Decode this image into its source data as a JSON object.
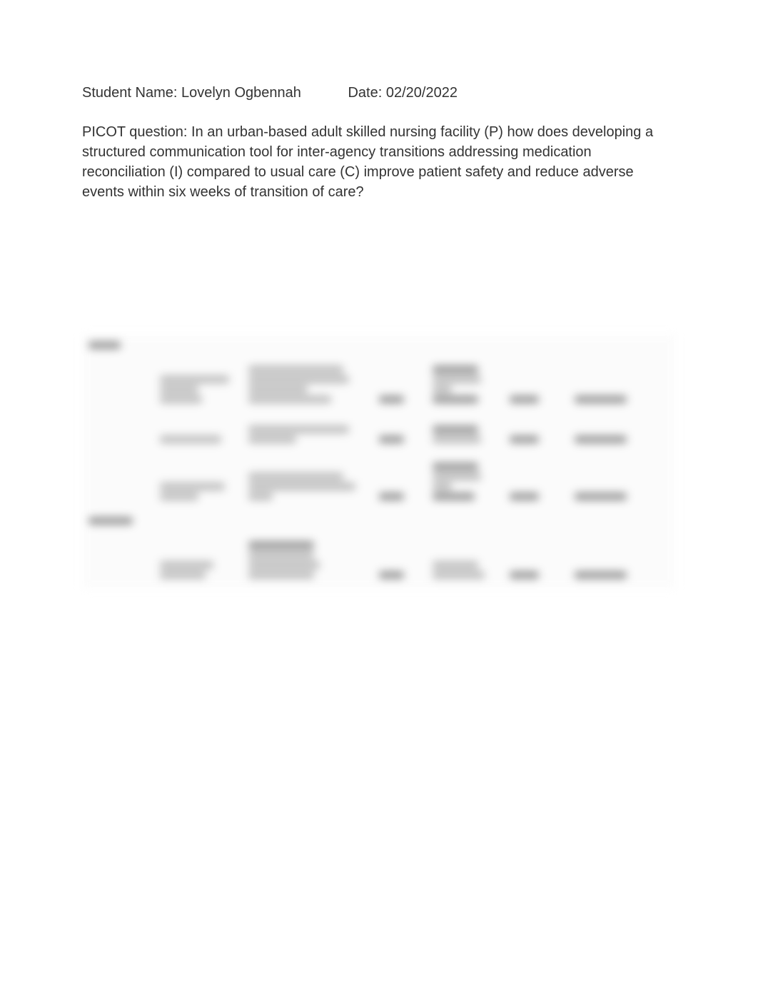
{
  "header": {
    "name_label": "Student Name:",
    "name_value": "Lovelyn Ogbennah",
    "date_label": "Date:",
    "date_value": "02/20/2022"
  },
  "picot": {
    "label": "PICOT question:",
    "text": "In an urban-based adult skilled nursing facility (P) how does developing a structured communication tool for inter-agency transitions addressing medication reconciliation (I) compared to usual care (C) improve patient safety and reduce adverse events within six weeks of transition of care?"
  }
}
